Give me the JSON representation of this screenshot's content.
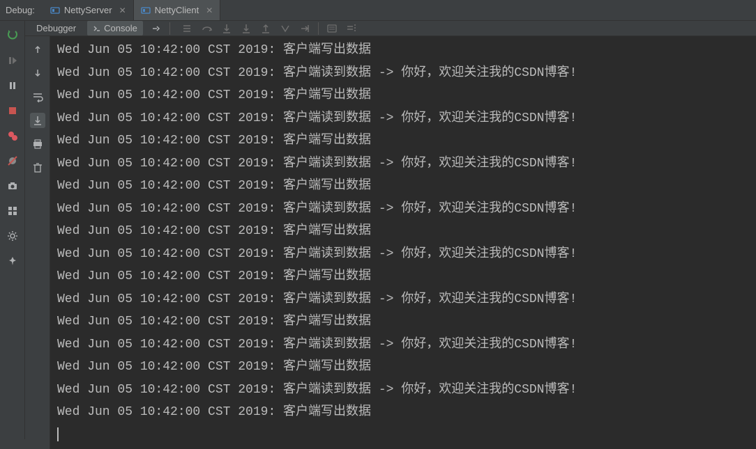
{
  "topbar": {
    "debug_label": "Debug:",
    "tabs": [
      {
        "label": "NettyServer",
        "active": false
      },
      {
        "label": "NettyClient",
        "active": true
      }
    ]
  },
  "subbar": {
    "debugger_label": "Debugger",
    "console_label": "Console"
  },
  "console_lines": [
    "Wed Jun 05 10:42:00 CST 2019: 客户端写出数据",
    "Wed Jun 05 10:42:00 CST 2019: 客户端读到数据 -> 你好，欢迎关注我的CSDN博客!",
    "Wed Jun 05 10:42:00 CST 2019: 客户端写出数据",
    "Wed Jun 05 10:42:00 CST 2019: 客户端读到数据 -> 你好，欢迎关注我的CSDN博客!",
    "Wed Jun 05 10:42:00 CST 2019: 客户端写出数据",
    "Wed Jun 05 10:42:00 CST 2019: 客户端读到数据 -> 你好，欢迎关注我的CSDN博客!",
    "Wed Jun 05 10:42:00 CST 2019: 客户端写出数据",
    "Wed Jun 05 10:42:00 CST 2019: 客户端读到数据 -> 你好，欢迎关注我的CSDN博客!",
    "Wed Jun 05 10:42:00 CST 2019: 客户端写出数据",
    "Wed Jun 05 10:42:00 CST 2019: 客户端读到数据 -> 你好，欢迎关注我的CSDN博客!",
    "Wed Jun 05 10:42:00 CST 2019: 客户端写出数据",
    "Wed Jun 05 10:42:00 CST 2019: 客户端读到数据 -> 你好，欢迎关注我的CSDN博客!",
    "Wed Jun 05 10:42:00 CST 2019: 客户端写出数据",
    "Wed Jun 05 10:42:00 CST 2019: 客户端读到数据 -> 你好，欢迎关注我的CSDN博客!",
    "Wed Jun 05 10:42:00 CST 2019: 客户端写出数据",
    "Wed Jun 05 10:42:00 CST 2019: 客户端读到数据 -> 你好，欢迎关注我的CSDN博客!",
    "Wed Jun 05 10:42:00 CST 2019: 客户端写出数据"
  ]
}
